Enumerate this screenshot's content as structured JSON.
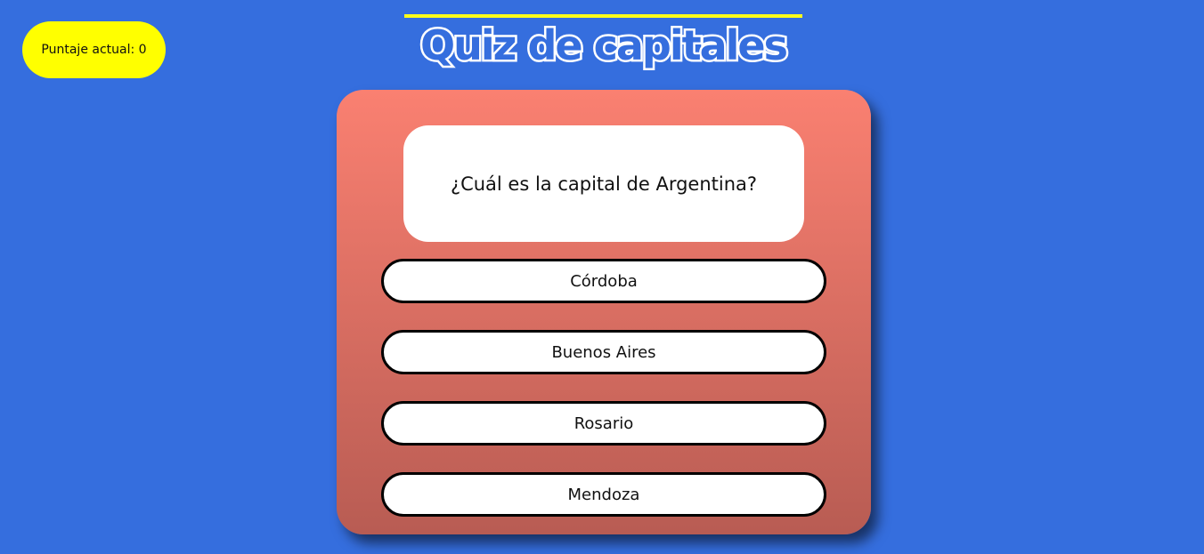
{
  "score": {
    "label": "Puntaje actual: 0"
  },
  "header": {
    "title": "Quiz de capitales"
  },
  "quiz": {
    "question": "¿Cuál es la capital de Argentina?",
    "answers": [
      "Córdoba",
      "Buenos Aires",
      "Rosario",
      "Mendoza"
    ]
  },
  "colors": {
    "background": "#356ede",
    "score_badge": "#ffff00",
    "title_line": "#ffff1a",
    "card_top": "#fa8071",
    "card_bottom": "#b85c53"
  }
}
